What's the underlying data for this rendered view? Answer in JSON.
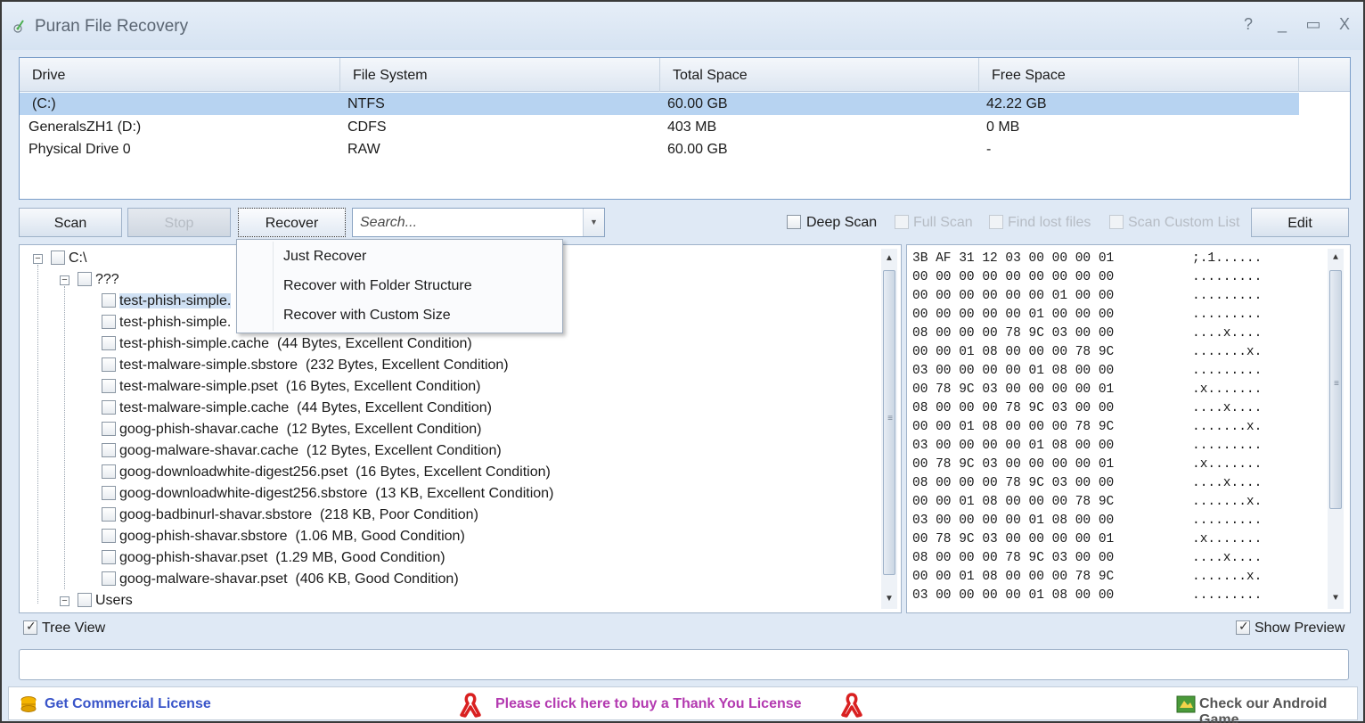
{
  "window": {
    "title": "Puran File Recovery",
    "controls": {
      "help": "?",
      "minimize": "_",
      "maximize": "▭",
      "close": "X"
    }
  },
  "drives": {
    "columns": [
      "Drive",
      "File System",
      "Total Space",
      "Free Space"
    ],
    "rows": [
      {
        "drive": "(C:)",
        "fs": "NTFS",
        "total": "60.00 GB",
        "free": "42.22 GB",
        "selected": true
      },
      {
        "drive": "GeneralsZH1 (D:)",
        "fs": "CDFS",
        "total": "403 MB",
        "free": "0 MB",
        "selected": false
      },
      {
        "drive": "Physical Drive 0",
        "fs": "RAW",
        "total": "60.00 GB",
        "free": "-",
        "selected": false
      }
    ]
  },
  "toolbar": {
    "scan": "Scan",
    "stop": "Stop",
    "recover": "Recover",
    "search_placeholder": "Search...",
    "deep_scan": "Deep Scan",
    "full_scan": "Full Scan",
    "find_lost": "Find lost files",
    "scan_custom": "Scan Custom List",
    "edit": "Edit"
  },
  "recover_menu": [
    "Just Recover",
    "Recover with Folder Structure",
    "Recover with Custom Size"
  ],
  "tree": {
    "root": "C:\\",
    "folder": "???",
    "files": [
      {
        "name": "test-phish-simple.",
        "detail": ""
      },
      {
        "name": "test-phish-simple.",
        "detail": ""
      },
      {
        "name": "test-phish-simple.cache",
        "detail": "(44 Bytes, Excellent Condition)"
      },
      {
        "name": "test-malware-simple.sbstore",
        "detail": "(232 Bytes, Excellent Condition)"
      },
      {
        "name": "test-malware-simple.pset",
        "detail": "(16 Bytes, Excellent Condition)"
      },
      {
        "name": "test-malware-simple.cache",
        "detail": "(44 Bytes, Excellent Condition)"
      },
      {
        "name": "goog-phish-shavar.cache",
        "detail": "(12 Bytes, Excellent Condition)"
      },
      {
        "name": "goog-malware-shavar.cache",
        "detail": "(12 Bytes, Excellent Condition)"
      },
      {
        "name": "goog-downloadwhite-digest256.pset",
        "detail": "(16 Bytes, Excellent Condition)"
      },
      {
        "name": "goog-downloadwhite-digest256.sbstore",
        "detail": "(13 KB, Excellent Condition)"
      },
      {
        "name": "goog-badbinurl-shavar.sbstore",
        "detail": "(218 KB, Poor Condition)"
      },
      {
        "name": "goog-phish-shavar.sbstore",
        "detail": "(1.06 MB, Good Condition)"
      },
      {
        "name": "goog-phish-shavar.pset",
        "detail": "(1.29 MB, Good Condition)"
      },
      {
        "name": "goog-malware-shavar.pset",
        "detail": "(406 KB, Good Condition)"
      }
    ],
    "users": "Users"
  },
  "hex": {
    "rows": [
      "3B AF 31 12 03 00 00 00 01",
      "00 00 00 00 00 00 00 00 00",
      "00 00 00 00 00 00 01 00 00",
      "00 00 00 00 00 01 00 00 00",
      "08 00 00 00 78 9C 03 00 00",
      "00 00 01 08 00 00 00 78 9C",
      "03 00 00 00 00 01 08 00 00",
      "00 78 9C 03 00 00 00 00 01",
      "08 00 00 00 78 9C 03 00 00",
      "00 00 01 08 00 00 00 78 9C",
      "03 00 00 00 00 01 08 00 00",
      "00 78 9C 03 00 00 00 00 01",
      "08 00 00 00 78 9C 03 00 00",
      "00 00 01 08 00 00 00 78 9C",
      "03 00 00 00 00 01 08 00 00",
      "00 78 9C 03 00 00 00 00 01",
      "08 00 00 00 78 9C 03 00 00",
      "00 00 01 08 00 00 00 78 9C",
      "03 00 00 00 00 01 08 00 00"
    ],
    "ascii": [
      ";.1......",
      ".........",
      ".........",
      ".........",
      "....x....",
      ".......x.",
      ".........",
      ".x.......",
      "....x....",
      ".......x.",
      ".........",
      ".x.......",
      "....x....",
      ".......x.",
      ".........",
      ".x.......",
      "....x....",
      ".......x.",
      "........."
    ]
  },
  "bottom": {
    "tree_view": "Tree View",
    "show_preview": "Show Preview"
  },
  "footer": {
    "commercial": "Get Commercial License",
    "thank_you": "Please click here to buy a Thank You License",
    "android": "Check our Android Game"
  },
  "colors": {
    "accent_link": "#3a55c9",
    "thank_you_link": "#b33ab0",
    "ribbon": "#d92020",
    "selection": "#b7d3f1"
  }
}
